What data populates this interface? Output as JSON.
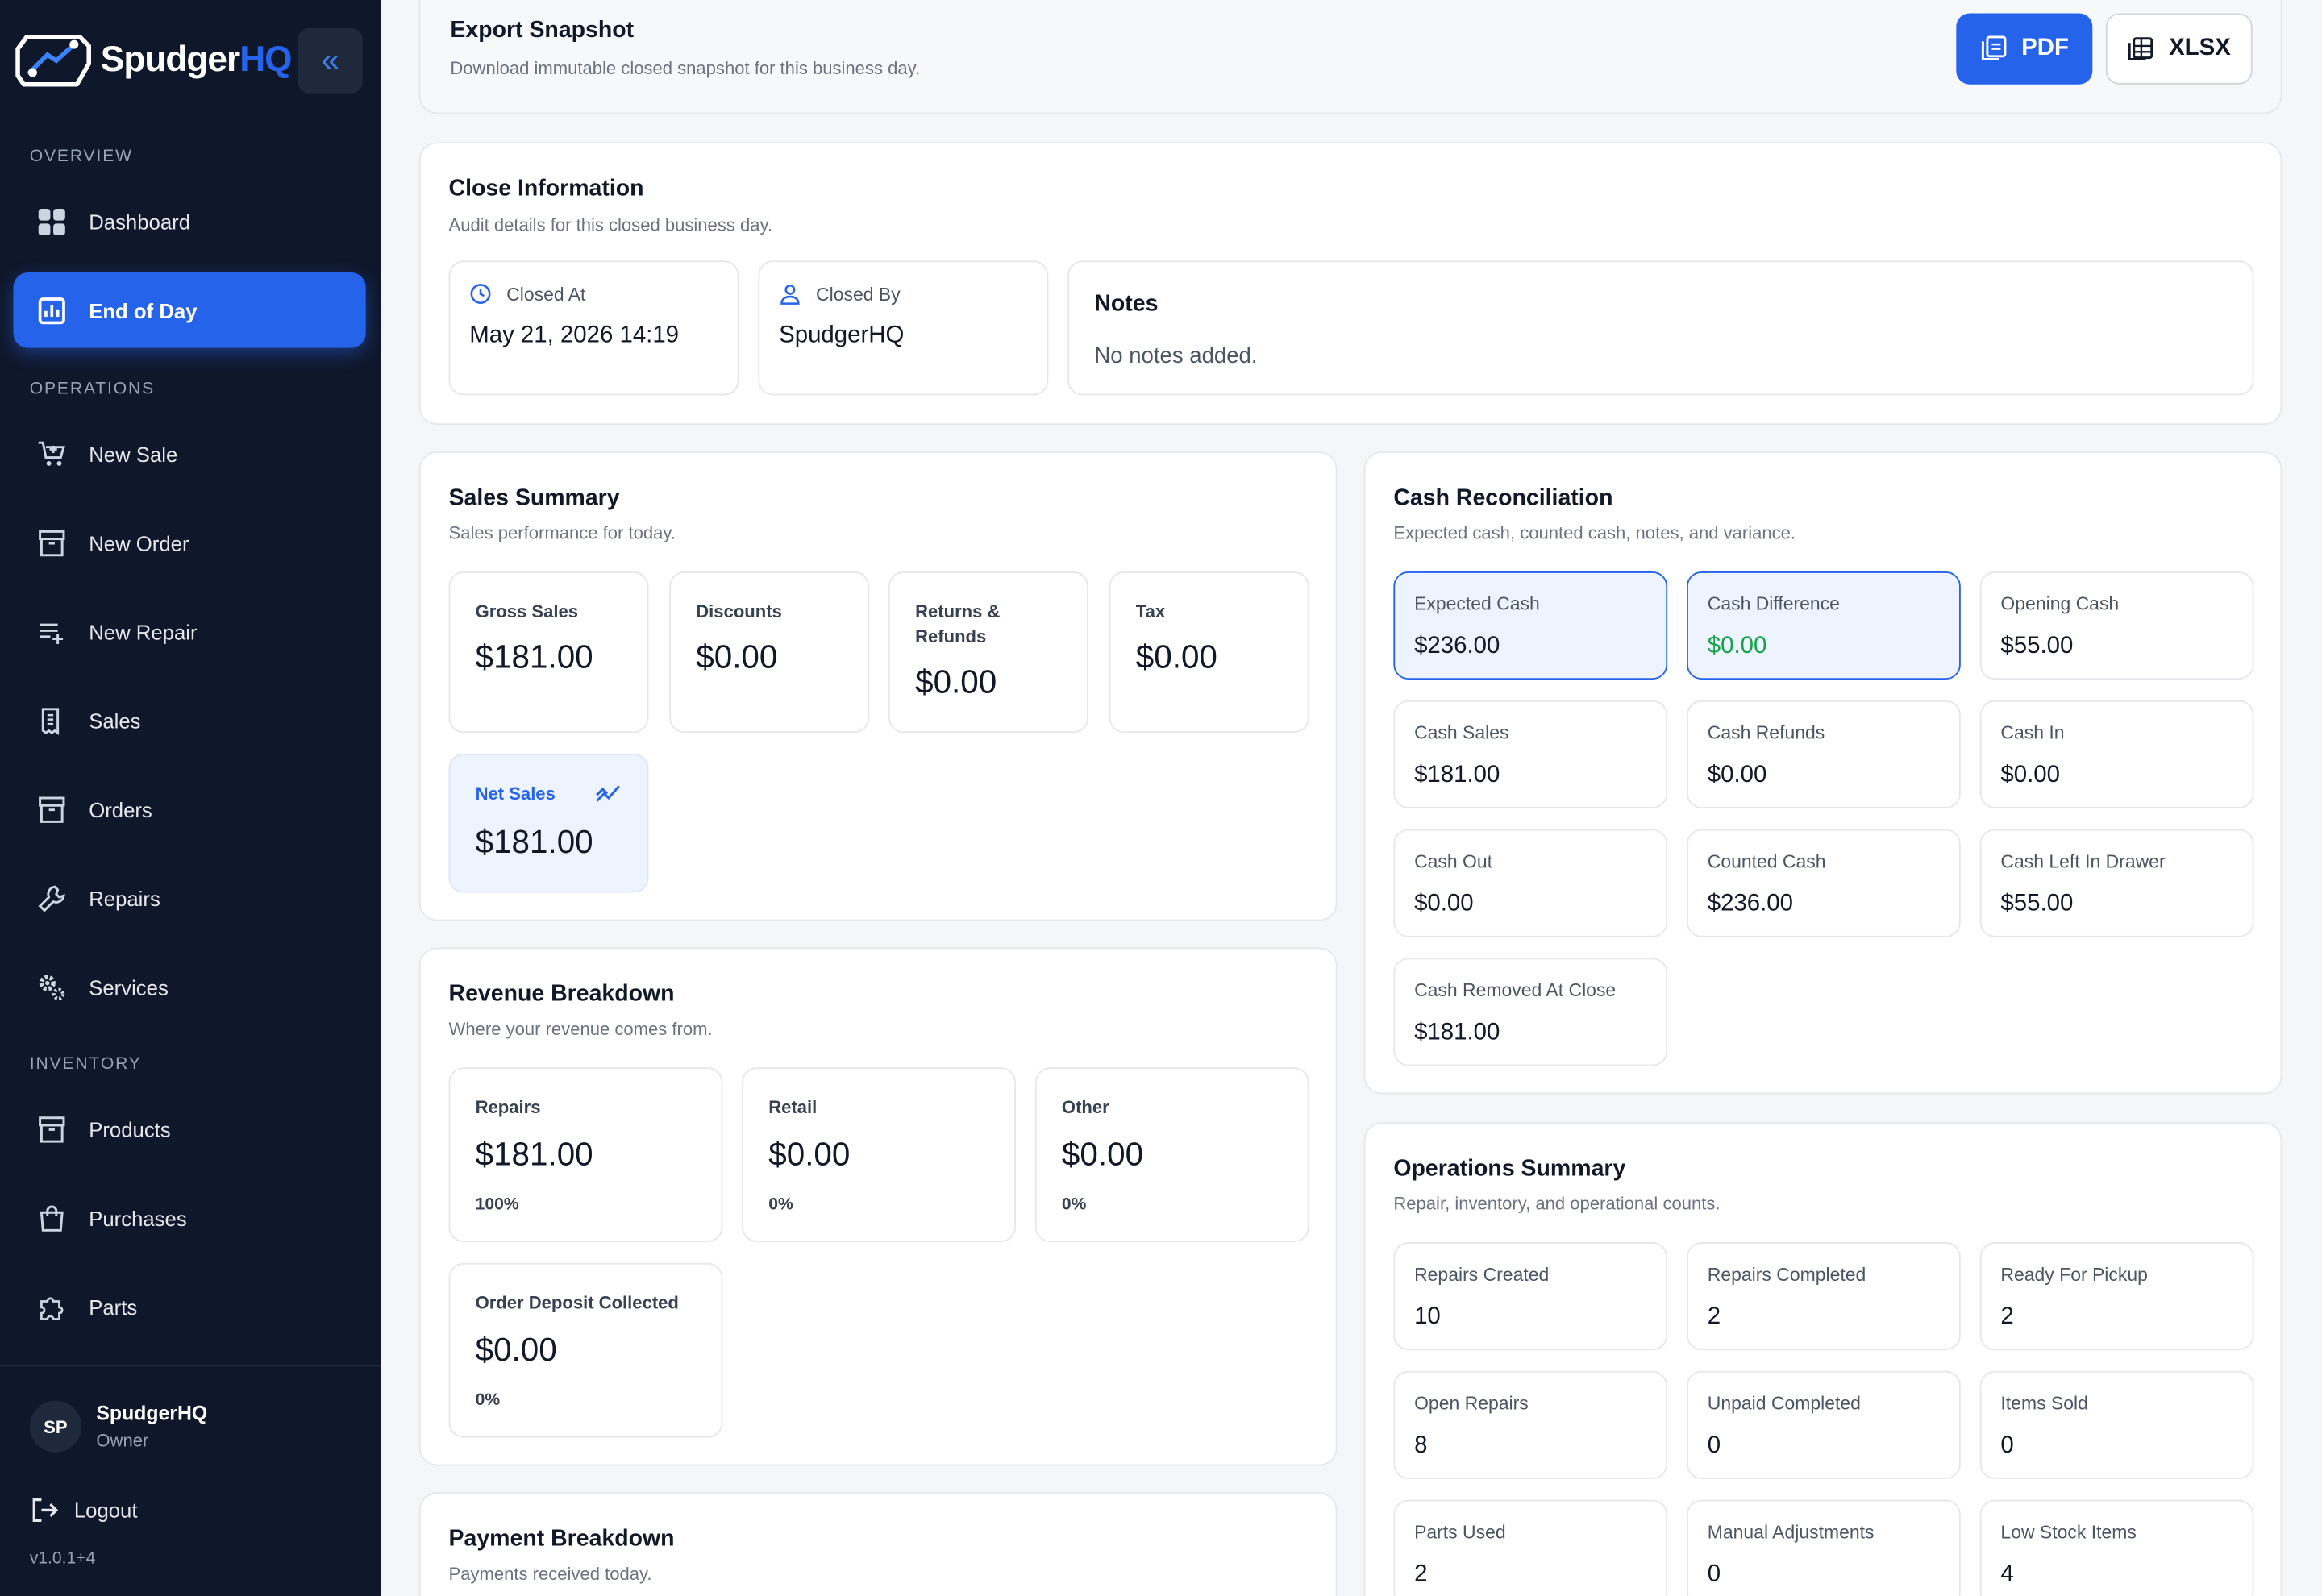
{
  "brand": {
    "name_a": "Spudger",
    "name_b": "HQ"
  },
  "sidebar": {
    "sections": {
      "overview": "OVERVIEW",
      "operations": "OPERATIONS",
      "inventory": "INVENTORY"
    },
    "items": [
      {
        "label": "Dashboard",
        "icon": "dashboard-icon"
      },
      {
        "label": "End of Day",
        "icon": "chart-icon",
        "active": true
      },
      {
        "label": "New Sale",
        "icon": "cart-plus-icon"
      },
      {
        "label": "New Order",
        "icon": "archive-icon"
      },
      {
        "label": "New Repair",
        "icon": "list-plus-icon"
      },
      {
        "label": "Sales",
        "icon": "receipt-icon"
      },
      {
        "label": "Orders",
        "icon": "archive-icon"
      },
      {
        "label": "Repairs",
        "icon": "wrench-icon"
      },
      {
        "label": "Services",
        "icon": "gears-icon"
      },
      {
        "label": "Products",
        "icon": "archive-icon"
      },
      {
        "label": "Purchases",
        "icon": "bag-icon"
      },
      {
        "label": "Parts",
        "icon": "puzzle-icon"
      }
    ],
    "user": {
      "initials": "SP",
      "name": "SpudgerHQ",
      "role": "Owner"
    },
    "logout": "Logout",
    "version": "v1.0.1+4"
  },
  "export": {
    "title": "Export Snapshot",
    "subtitle": "Download immutable closed snapshot for this business day.",
    "pdf": "PDF",
    "xlsx": "XLSX"
  },
  "close_info": {
    "title": "Close Information",
    "subtitle": "Audit details for this closed business day.",
    "closed_at_label": "Closed At",
    "closed_at": "May 21, 2026 14:19",
    "closed_by_label": "Closed By",
    "closed_by": "SpudgerHQ",
    "notes_label": "Notes",
    "notes": "No notes added."
  },
  "sales_summary": {
    "title": "Sales Summary",
    "subtitle": "Sales performance for today.",
    "gross_label": "Gross Sales",
    "gross": "$181.00",
    "discounts_label": "Discounts",
    "discounts": "$0.00",
    "returns_label_1": "Returns &",
    "returns_label_2": "Refunds",
    "returns": "$0.00",
    "tax_label": "Tax",
    "tax": "$0.00",
    "net_label": "Net Sales",
    "net": "$181.00"
  },
  "revenue": {
    "title": "Revenue Breakdown",
    "subtitle": "Where your revenue comes from.",
    "repairs_label": "Repairs",
    "repairs": "$181.00",
    "repairs_pct": "100%",
    "retail_label": "Retail",
    "retail": "$0.00",
    "retail_pct": "0%",
    "other_label": "Other",
    "other": "$0.00",
    "other_pct": "0%",
    "deposit_label": "Order Deposit Collected",
    "deposit": "$0.00",
    "deposit_pct": "0%"
  },
  "payment": {
    "title": "Payment Breakdown",
    "subtitle": "Payments received today."
  },
  "cash": {
    "title": "Cash Reconciliation",
    "subtitle": "Expected cash, counted cash, notes, and variance.",
    "expected_label": "Expected Cash",
    "expected": "$236.00",
    "difference_label": "Cash Difference",
    "difference": "$0.00",
    "opening_label": "Opening Cash",
    "opening": "$55.00",
    "sales_label": "Cash Sales",
    "sales": "$181.00",
    "refunds_label": "Cash Refunds",
    "refunds": "$0.00",
    "in_label": "Cash In",
    "in": "$0.00",
    "out_label": "Cash Out",
    "out": "$0.00",
    "counted_label": "Counted Cash",
    "counted": "$236.00",
    "left_label": "Cash Left In Drawer",
    "left": "$55.00",
    "removed_label": "Cash Removed At Close",
    "removed": "$181.00"
  },
  "ops": {
    "title": "Operations Summary",
    "subtitle": "Repair, inventory, and operational counts.",
    "created_label": "Repairs Created",
    "created": "10",
    "completed_label": "Repairs Completed",
    "completed": "2",
    "pickup_label": "Ready For Pickup",
    "pickup": "2",
    "open_label": "Open Repairs",
    "open": "8",
    "unpaid_label": "Unpaid Completed",
    "unpaid": "0",
    "sold_label": "Items Sold",
    "sold": "0",
    "parts_label": "Parts Used",
    "parts": "2",
    "manual_label": "Manual Adjustments",
    "manual": "0",
    "lowstock_label": "Low Stock Items",
    "lowstock": "4"
  },
  "colors": {
    "accent": "#2563eb",
    "sidebar": "#0f172a",
    "positive": "#16a34a"
  }
}
